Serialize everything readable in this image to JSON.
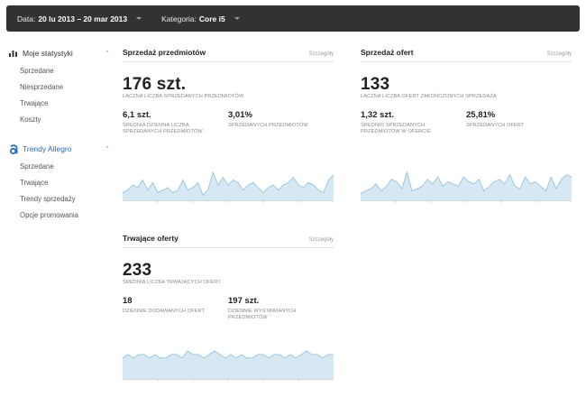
{
  "topbar": {
    "date_label": "Data:",
    "date_value": "20 lu 2013 – 20 mar 2013",
    "category_label": "Kategoria:",
    "category_value": "Core i5"
  },
  "sidebar": {
    "stats": {
      "title": "Moje statystyki",
      "icon": "bar-chart-icon",
      "items": [
        "Sprzedane",
        "Niesprzedane",
        "Trwające",
        "Koszty"
      ]
    },
    "trends": {
      "title": "Trendy Allegro",
      "icon": "allegro-logo-icon",
      "items": [
        "Sprzedane",
        "Trwające",
        "Trendy sprzedaży",
        "Opcje promowania"
      ]
    }
  },
  "cards": {
    "items": {
      "title": "Sprzedaż przedmiotów",
      "link": "Szczegóły",
      "big_value": "176 szt.",
      "big_caption": "ŁĄCZNA LICZBA SPRZEDANYCH PRZEDMIOTÓW",
      "stats": [
        {
          "value": "6,1 szt.",
          "caption": "ŚREDNIA DZIENNA LICZBA SPRZEDANYCH PRZEDMIOTÓW"
        },
        {
          "value": "3,01%",
          "caption": "SPRZEDANYCH PRZEDMIOTÓW"
        }
      ]
    },
    "offers": {
      "title": "Sprzedaż ofert",
      "link": "Szczegóły",
      "big_value": "133",
      "big_caption": "ŁĄCZNA LICZBA OFERT ZAKOŃCZONYCH SPRZEDAŻĄ",
      "stats": [
        {
          "value": "1,32 szt.",
          "caption": "ŚREDNIO SPRZEDANYCH PRZEDMIOTÓW W OFERCIE"
        },
        {
          "value": "25,81%",
          "caption": "SPRZEDANYCH OFERT"
        }
      ]
    },
    "ongoing": {
      "title": "Trwające oferty",
      "link": "Szczegóły",
      "big_value": "233",
      "big_caption": "ŚREDNIA LICZBA TRWAJĄCYCH OFERT",
      "stats": [
        {
          "value": "18",
          "caption": "DZIENNIE DODAWANYCH OFERT"
        },
        {
          "value": "197 szt.",
          "caption": "DZIENNIE WYSTAWIANYCH PRZEDMIOTÓW"
        }
      ]
    }
  },
  "sparklines": {
    "color_fill": "#d6e8f3",
    "color_line": "#8fbedb",
    "items": [
      3,
      4,
      6,
      5,
      8,
      4,
      7,
      3,
      4,
      5,
      3,
      4,
      8,
      4,
      5,
      7,
      2,
      4,
      11,
      6,
      9,
      6,
      8,
      7,
      4,
      6,
      7,
      5,
      3,
      5,
      6,
      4,
      6,
      7,
      9,
      6,
      5,
      7,
      6,
      4,
      3,
      8,
      10
    ],
    "offers": [
      3,
      4,
      5,
      7,
      4,
      6,
      9,
      8,
      5,
      12,
      4,
      5,
      6,
      9,
      7,
      10,
      6,
      8,
      7,
      6,
      10,
      8,
      7,
      9,
      4,
      6,
      8,
      9,
      7,
      11,
      6,
      5,
      10,
      7,
      8,
      6,
      4,
      10,
      5,
      9,
      11,
      10
    ],
    "ongoing": [
      6,
      7,
      6,
      7,
      7,
      6,
      7,
      6,
      6,
      7,
      7,
      6,
      8,
      7,
      7,
      6,
      7,
      8,
      7,
      6,
      7,
      6,
      7,
      6,
      6,
      7,
      7,
      6,
      7,
      7,
      6,
      7,
      6,
      7,
      8,
      7,
      7,
      6,
      7,
      7
    ]
  }
}
